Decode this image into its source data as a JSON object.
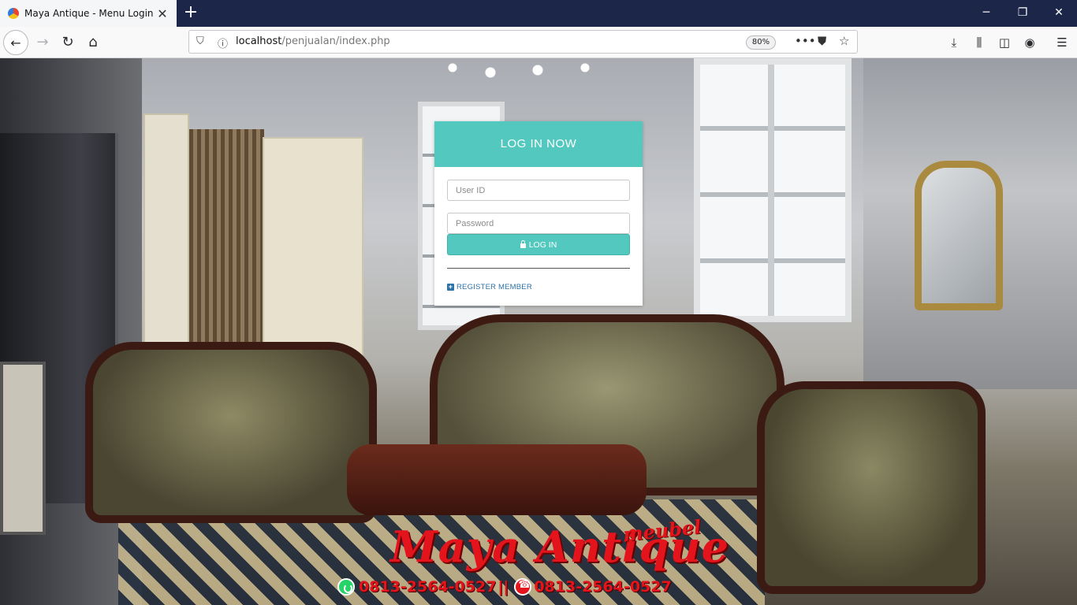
{
  "browser": {
    "tab_title": "Maya Antique - Menu Login",
    "url_host": "localhost",
    "url_path": "/penjualan/index.php",
    "zoom": "80%"
  },
  "login": {
    "header": "LOG IN NOW",
    "user_placeholder": "User ID",
    "password_placeholder": "Password",
    "login_button": "LOG IN",
    "register_link": "REGISTER MEMBER"
  },
  "brand": {
    "name": "Maya Antique",
    "subtitle": "meubel",
    "phone_1": "0813-2564-0527",
    "separator": "||",
    "phone_2": "0813-2564-0527"
  },
  "icons": {
    "back": "back-arrow-icon",
    "forward": "forward-arrow-icon",
    "reload": "reload-icon",
    "home": "home-icon",
    "lock": "lock-icon",
    "plus": "plus-square-icon",
    "whatsapp": "whatsapp-icon",
    "phone": "phone-icon"
  },
  "colors": {
    "accent": "#52c8bf",
    "link": "#2d72a8",
    "brand_red": "#e3141b",
    "tabbar": "#1c2648"
  }
}
